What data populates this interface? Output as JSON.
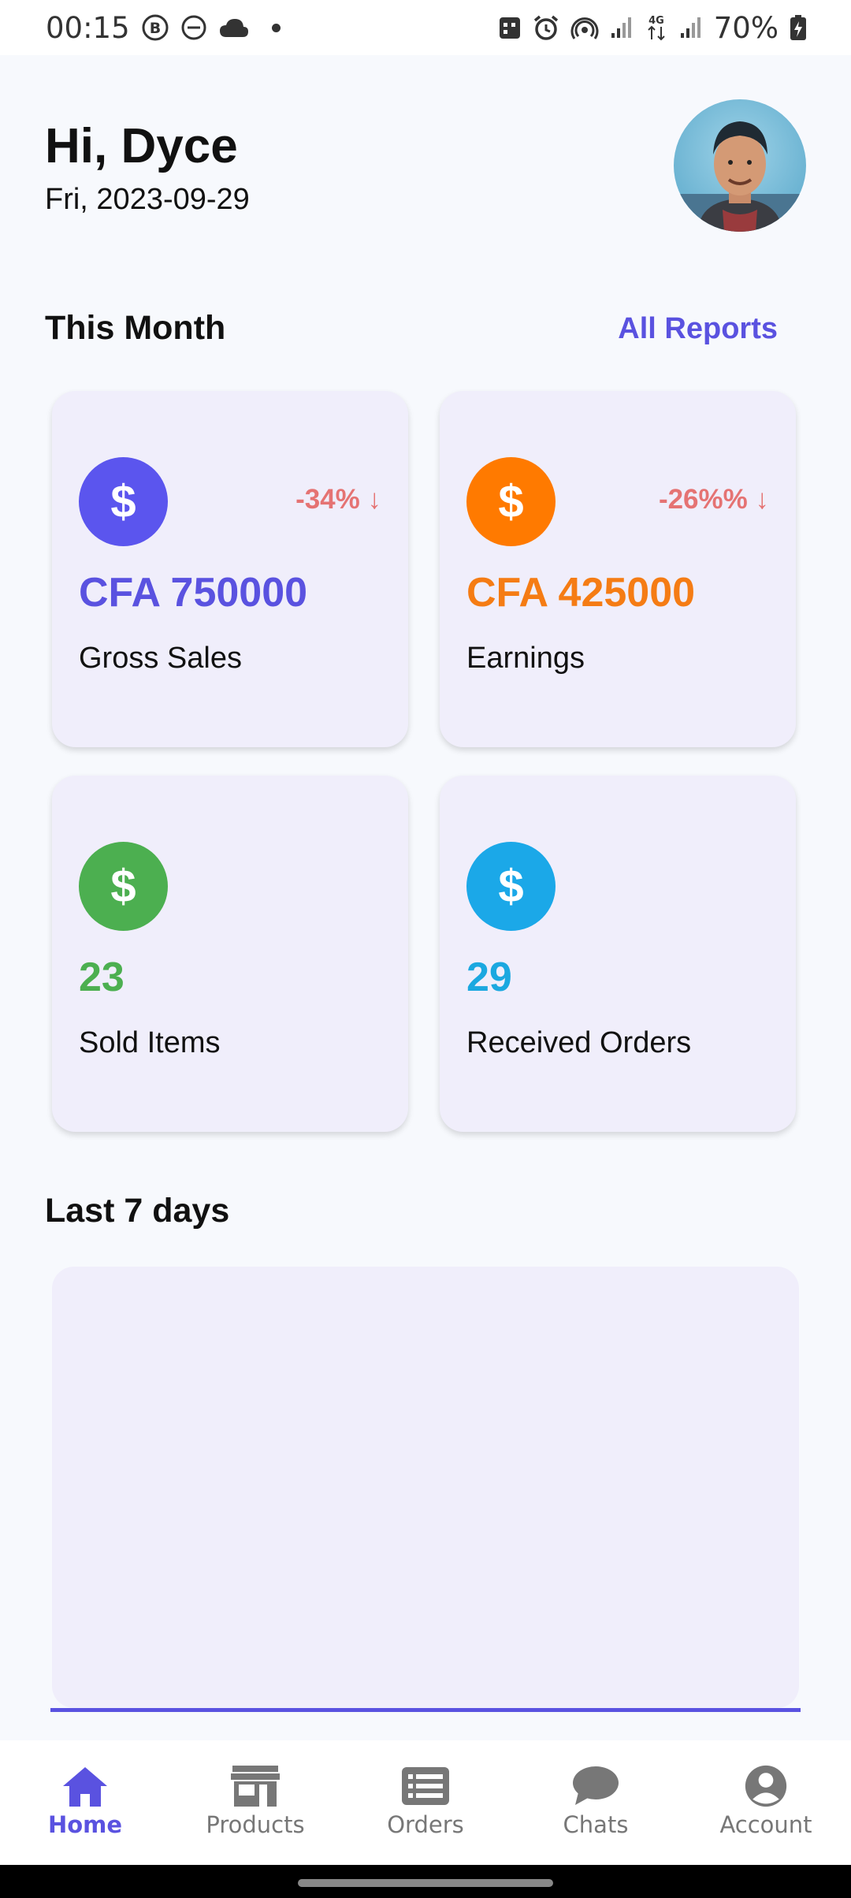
{
  "status_bar": {
    "time": "00:15",
    "battery": "70%",
    "network": "4G"
  },
  "header": {
    "greeting": "Hi, Dyce",
    "date": "Fri, 2023-09-29"
  },
  "this_month": {
    "title": "This Month",
    "link": "All Reports",
    "cards": [
      {
        "icon": "dollar-icon",
        "symbol": "$",
        "value": "CFA 750000",
        "label": "Gross Sales",
        "change": "-34% ↓",
        "color": "#5a52e0",
        "icon_bg": "#5b55ee"
      },
      {
        "icon": "dollar-icon",
        "symbol": "$",
        "value": "CFA 425000",
        "label": "Earnings",
        "change": "-26%% ↓",
        "color": "#f57c14",
        "icon_bg": "#ff7a00"
      },
      {
        "icon": "dollar-icon",
        "symbol": "$",
        "value": "23",
        "label": "Sold Items",
        "change": "",
        "color": "#4caf50",
        "icon_bg": "#4caf50"
      },
      {
        "icon": "dollar-icon",
        "symbol": "$",
        "value": "29",
        "label": "Received Orders",
        "change": "",
        "color": "#1ba8e0",
        "icon_bg": "#1ba8e8"
      }
    ]
  },
  "last_7_days": {
    "title": "Last 7 days"
  },
  "nav": {
    "items": [
      {
        "label": "Home",
        "icon": "home-icon",
        "active": true
      },
      {
        "label": "Products",
        "icon": "store-icon",
        "active": false
      },
      {
        "label": "Orders",
        "icon": "list-icon",
        "active": false
      },
      {
        "label": "Chats",
        "icon": "chat-bubble-icon",
        "active": false
      },
      {
        "label": "Account",
        "icon": "account-circle-icon",
        "active": false
      }
    ]
  }
}
